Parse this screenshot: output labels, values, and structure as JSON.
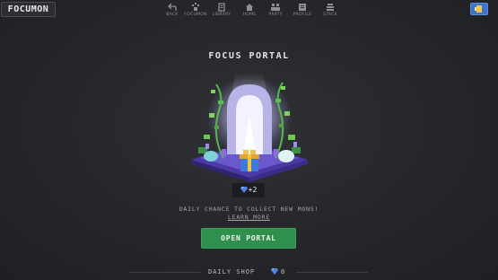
{
  "app": {
    "logo": "FOCUMON"
  },
  "nav": {
    "items": [
      {
        "label": "BACK",
        "icon": "back-arrow-icon"
      },
      {
        "label": "FOCUMON",
        "icon": "paw-icon"
      },
      {
        "label": "LIBRARY",
        "icon": "book-icon"
      },
      {
        "label": "HOME",
        "icon": "home-icon"
      },
      {
        "label": "PARTY",
        "icon": "party-icon"
      },
      {
        "label": "PROFILE",
        "icon": "profile-card-icon"
      },
      {
        "label": "STACK",
        "icon": "stack-icon"
      }
    ]
  },
  "top_right": {
    "icon": "card-collection-icon",
    "accent": "#3d73c9"
  },
  "portal": {
    "title": "FOCUS PORTAL",
    "reward_amount": "+2",
    "reward_icon": "gem-icon",
    "description": "DAILY CHANCE TO COLLECT NEW MONS!",
    "learn_more": "LEARN MORE",
    "open_button": "OPEN PORTAL",
    "button_color": "#2f8f4c"
  },
  "shop": {
    "label": "DAILY SHOP",
    "gem_icon": "gem-icon",
    "gem_count": "0"
  }
}
